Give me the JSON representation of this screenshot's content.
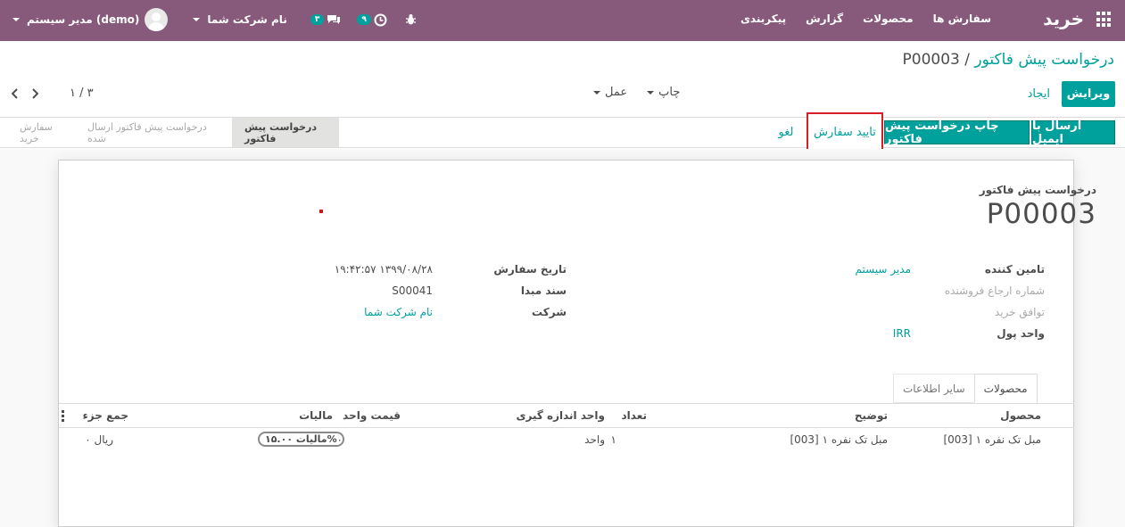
{
  "navbar": {
    "brand": "خرید",
    "menu": [
      "سفارش ها",
      "محصولات",
      "گزارش",
      "پیکربندی"
    ],
    "user": "مدیر سیستم (demo)",
    "company": "نام شرکت شما",
    "messages_count": "۳",
    "activities_count": "۹"
  },
  "breadcrumb": {
    "parent": "درخواست پیش فاکتور",
    "separator": "/",
    "current": "P00003"
  },
  "controls": {
    "edit": "ویرایش",
    "create": "ایجاد",
    "print": "چاپ",
    "action": "عمل",
    "pager": "۳ / ۱"
  },
  "header_buttons": {
    "send_email": "ارسال با ایمیل",
    "print_rfq": "چاپ درخواست پیش فاکتور",
    "confirm_order": "تایید سفارش",
    "cancel": "لغو"
  },
  "stages": [
    "درخواست پیش فاکتور",
    "درخواست پیش فاکتور ارسال شده",
    "سفارش خرید"
  ],
  "form": {
    "doc_label": "درخواست پیش فاکتور",
    "doc_name": "P00003",
    "vendor_label": "تامین کننده",
    "vendor_value": "مدیر سیستم",
    "vendor_ref_label": "شماره ارجاع فروشنده",
    "agreement_label": "توافق خرید",
    "currency_label": "واحد پول",
    "currency_value": "IRR",
    "order_date_label": "تاریخ سفارش",
    "order_date_value": "۱۹:۴۲:۵۷ ۱۳۹۹/۰۸/۲۸",
    "source_label": "سند مبدا",
    "source_value": "S00041",
    "company_label": "شرکت",
    "company_value": "نام شرکت شما"
  },
  "tabs": [
    "محصولات",
    "سایر اطلاعات"
  ],
  "table": {
    "headers": [
      "محصول",
      "توضیح",
      "تعداد",
      "واحد اندازه گیری",
      "قیمت واحد",
      "مالیات",
      "جمع جزء"
    ],
    "rows": [
      {
        "product": "[003] مبل تک نفره ۱",
        "description": "[003] مبل تک نفره ۱",
        "qty": "۱",
        "uom": "واحد",
        "price": "۰",
        "tax": "مالیات ۱۵.۰۰%",
        "subtotal": "۰ ریال"
      }
    ]
  }
}
